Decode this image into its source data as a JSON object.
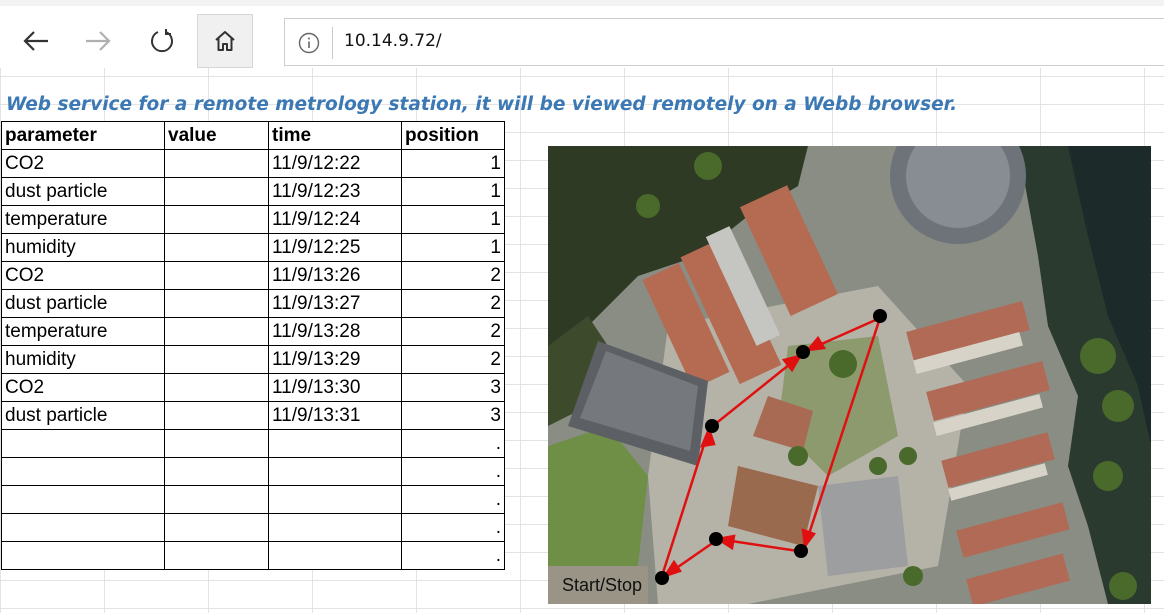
{
  "browser": {
    "url": "10.14.9.72/",
    "back_icon": "arrow-left-icon",
    "forward_icon": "arrow-right-icon",
    "refresh_icon": "refresh-icon",
    "home_icon": "home-icon",
    "info_icon": "info-icon"
  },
  "heading": "Web service for a remote metrology station, it will be viewed remotely on a Webb browser.",
  "table": {
    "headers": [
      "parameter",
      "value",
      "time",
      "position"
    ],
    "rows": [
      {
        "parameter": "CO2",
        "value": "",
        "time": "11/9/12:22",
        "position": "1"
      },
      {
        "parameter": "dust particle",
        "value": "",
        "time": "11/9/12:23",
        "position": "1"
      },
      {
        "parameter": "temperature",
        "value": "",
        "time": "11/9/12:24",
        "position": "1"
      },
      {
        "parameter": "humidity",
        "value": "",
        "time": "11/9/12:25",
        "position": "1"
      },
      {
        "parameter": "CO2",
        "value": "",
        "time": "11/9/13:26",
        "position": "2"
      },
      {
        "parameter": "dust particle",
        "value": "",
        "time": "11/9/13:27",
        "position": "2"
      },
      {
        "parameter": "temperature",
        "value": "",
        "time": "11/9/13:28",
        "position": "2"
      },
      {
        "parameter": "humidity",
        "value": "",
        "time": "11/9/13:29",
        "position": "2"
      },
      {
        "parameter": "CO2",
        "value": "",
        "time": "11/9/13:30",
        "position": "3"
      },
      {
        "parameter": "dust particle",
        "value": "",
        "time": "11/9/13:31",
        "position": "3"
      },
      {
        "parameter": "",
        "value": "",
        "time": "",
        "position": "."
      },
      {
        "parameter": "",
        "value": "",
        "time": "",
        "position": "."
      },
      {
        "parameter": "",
        "value": "",
        "time": "",
        "position": "."
      },
      {
        "parameter": "",
        "value": "",
        "time": "",
        "position": "."
      },
      {
        "parameter": "",
        "value": "",
        "time": "",
        "position": "."
      }
    ]
  },
  "map": {
    "label": "Start/Stop",
    "route_color": "#e01010",
    "waypoint_color": "#000000"
  },
  "colors": {
    "heading": "#3b78b4"
  }
}
